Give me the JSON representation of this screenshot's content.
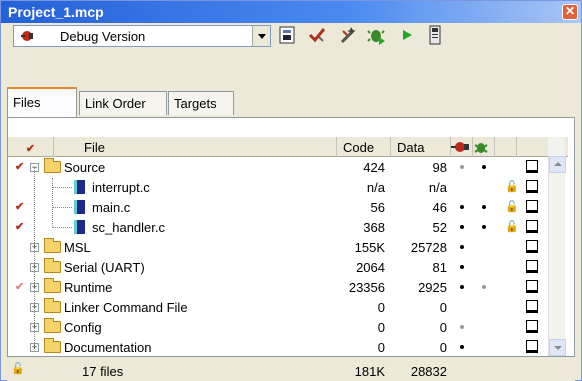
{
  "window": {
    "title": "Project_1.mcp",
    "close_glyph": "✕"
  },
  "toolbar": {
    "config_value": "Debug Version",
    "icons": [
      "build-all-icon",
      "check-project-icon",
      "magic-wand-icon",
      "debug-run-icon",
      "run-icon",
      "device-icon"
    ]
  },
  "tabs": [
    {
      "label": "Files",
      "active": true
    },
    {
      "label": "Link Order",
      "active": false
    },
    {
      "label": "Targets",
      "active": false
    }
  ],
  "columns": {
    "check": "✔",
    "file": "File",
    "code": "Code",
    "data": "Data"
  },
  "rows": [
    {
      "name": "Source",
      "type": "folder",
      "expanded": true,
      "checked": true,
      "code": "424",
      "data": "98",
      "dot1": "gray",
      "dot2": "black",
      "lock": false
    },
    {
      "name": "interrupt.c",
      "type": "file",
      "checked": false,
      "code": "n/a",
      "data": "n/a",
      "dot1": "",
      "dot2": "",
      "lock": true
    },
    {
      "name": "main.c",
      "type": "file",
      "checked": true,
      "code": "56",
      "data": "46",
      "dot1": "black",
      "dot2": "black",
      "lock": true
    },
    {
      "name": "sc_handler.c",
      "type": "file",
      "checked": true,
      "code": "368",
      "data": "52",
      "dot1": "black",
      "dot2": "black",
      "lock": true
    },
    {
      "name": "MSL",
      "type": "folder",
      "expanded": false,
      "checked": false,
      "code": "155K",
      "data": "25728",
      "dot1": "black",
      "dot2": "",
      "lock": false
    },
    {
      "name": "Serial (UART)",
      "type": "folder",
      "expanded": false,
      "checked": false,
      "code": "2064",
      "data": "81",
      "dot1": "black",
      "dot2": "",
      "lock": false
    },
    {
      "name": "Runtime",
      "type": "folder",
      "expanded": false,
      "checked": true,
      "faint": true,
      "code": "23356",
      "data": "2925",
      "dot1": "black",
      "dot2": "gray",
      "lock": false
    },
    {
      "name": "Linker Command File",
      "type": "folder",
      "expanded": false,
      "checked": false,
      "code": "0",
      "data": "0",
      "dot1": "",
      "dot2": "",
      "lock": false
    },
    {
      "name": "Config",
      "type": "folder",
      "expanded": false,
      "checked": false,
      "code": "0",
      "data": "0",
      "dot1": "gray",
      "dot2": "",
      "lock": false
    },
    {
      "name": "Documentation",
      "type": "folder",
      "expanded": false,
      "checked": false,
      "code": "0",
      "data": "0",
      "dot1": "black",
      "dot2": "",
      "lock": false
    }
  ],
  "status": {
    "files": "17 files",
    "code_total": "181K",
    "data_total": "28832"
  },
  "colors": {
    "title_bar": "#2460d8",
    "check": "#b0301a",
    "tab_accent": "#e68b2c"
  }
}
